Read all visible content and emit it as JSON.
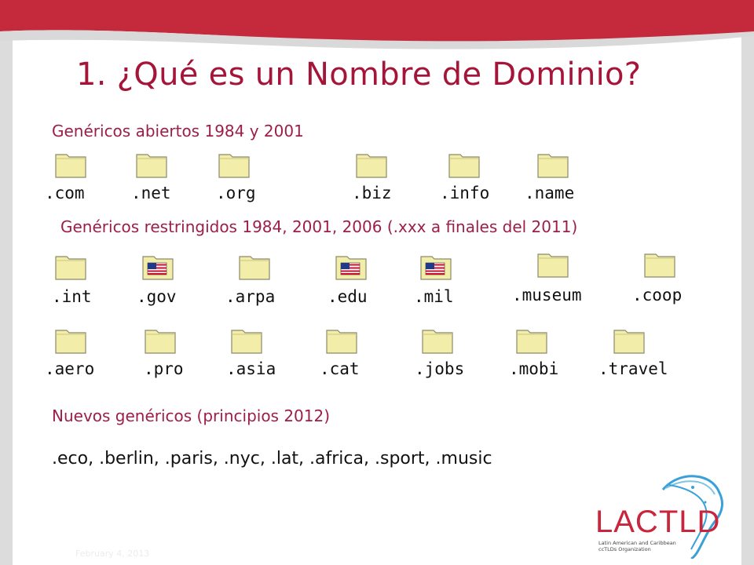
{
  "title": "1. ¿Qué es un Nombre de Dominio?",
  "sections": {
    "open": "Genéricos abiertos 1984 y 2001",
    "restricted": "Genéricos restringidos 1984, 2001, 2006 (.xxx a finales del 2011)",
    "new": "Nuevos genéricos (principios 2012)"
  },
  "open_tlds": [
    ".com",
    ".net",
    ".org",
    ".biz",
    ".info",
    ".name"
  ],
  "restricted_row1": [
    ".int",
    ".gov",
    ".arpa",
    ".edu",
    ".mil",
    ".museum",
    ".coop"
  ],
  "restricted_row2": [
    ".aero",
    ".pro",
    ".asia",
    ".cat",
    ".jobs",
    ".mobi",
    ".travel"
  ],
  "new_tlds": ".eco, .berlin, .paris, .nyc, .lat, .africa, .sport, .music",
  "footer_date": "February 4, 2013",
  "logo": {
    "name": "LACTLD",
    "subtitle_line1": "Latin American and Caribbean",
    "subtitle_line2": "ccTLDs Organization"
  },
  "colors": {
    "title": "#a5153a",
    "section": "#9b1f47",
    "folder_fill": "#f2eda8",
    "logo_red": "#c9253d",
    "map_blue": "#3aa0d8"
  },
  "icons": {
    "folder": "folder-icon",
    "flag_folder": "us-flag-folder-icon"
  }
}
